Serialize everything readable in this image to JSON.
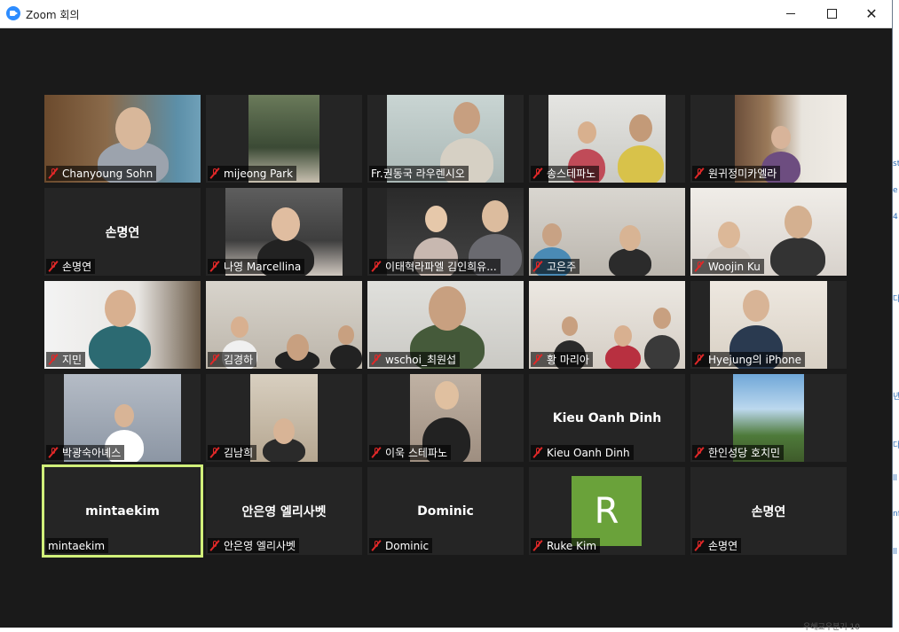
{
  "window": {
    "title": "Zoom 회의"
  },
  "participants": [
    {
      "name": "Chanyoung Sohn",
      "muted": true
    },
    {
      "name": "mijeong Park",
      "muted": true
    },
    {
      "name": "Fr.권동국 라우렌시오",
      "muted": false
    },
    {
      "name": "송스테파노",
      "muted": true
    },
    {
      "name": "원귀정미카엘라",
      "muted": true
    },
    {
      "name": "손명연",
      "muted": true,
      "display": "손명연"
    },
    {
      "name": "나영 Marcellina",
      "muted": true
    },
    {
      "name": "이태혁라파엘 김인희유...",
      "muted": true
    },
    {
      "name": "고은주",
      "muted": true
    },
    {
      "name": "Woojin Ku",
      "muted": true
    },
    {
      "name": "지민",
      "muted": true
    },
    {
      "name": "김경하",
      "muted": true
    },
    {
      "name": "wschoi_최원섭",
      "muted": true
    },
    {
      "name": "황 마리아",
      "muted": true
    },
    {
      "name": "Hyejung의 iPhone",
      "muted": true
    },
    {
      "name": "박광숙아녜스",
      "muted": true
    },
    {
      "name": "김남희",
      "muted": true
    },
    {
      "name": "이욱 스테파노",
      "muted": true
    },
    {
      "name": "Kieu Oanh Dinh",
      "muted": true,
      "display": "Kieu Oanh Dinh"
    },
    {
      "name": "한인성당 호치민",
      "muted": true
    },
    {
      "name": "mintaekim",
      "muted": false,
      "display": "mintaekim",
      "active": true
    },
    {
      "name": "안은영 엘리사벳",
      "muted": true,
      "display": "안은영 엘리사벳"
    },
    {
      "name": "Dominic",
      "muted": true,
      "display": "Dominic"
    },
    {
      "name": "Ruke Kim",
      "muted": true,
      "avatar_letter": "R"
    },
    {
      "name": "손명연",
      "muted": true,
      "display": "손명연"
    }
  ],
  "colors": {
    "active_speaker": "#d1f07a",
    "mute": "#e02828",
    "avatar_bg": "#6aa23a"
  },
  "side_text": "우혜교우분기 10",
  "side_chars": [
    "st",
    "e",
    "4",
    "다",
    "년",
    "다",
    "ll",
    "nf",
    "ll"
  ]
}
